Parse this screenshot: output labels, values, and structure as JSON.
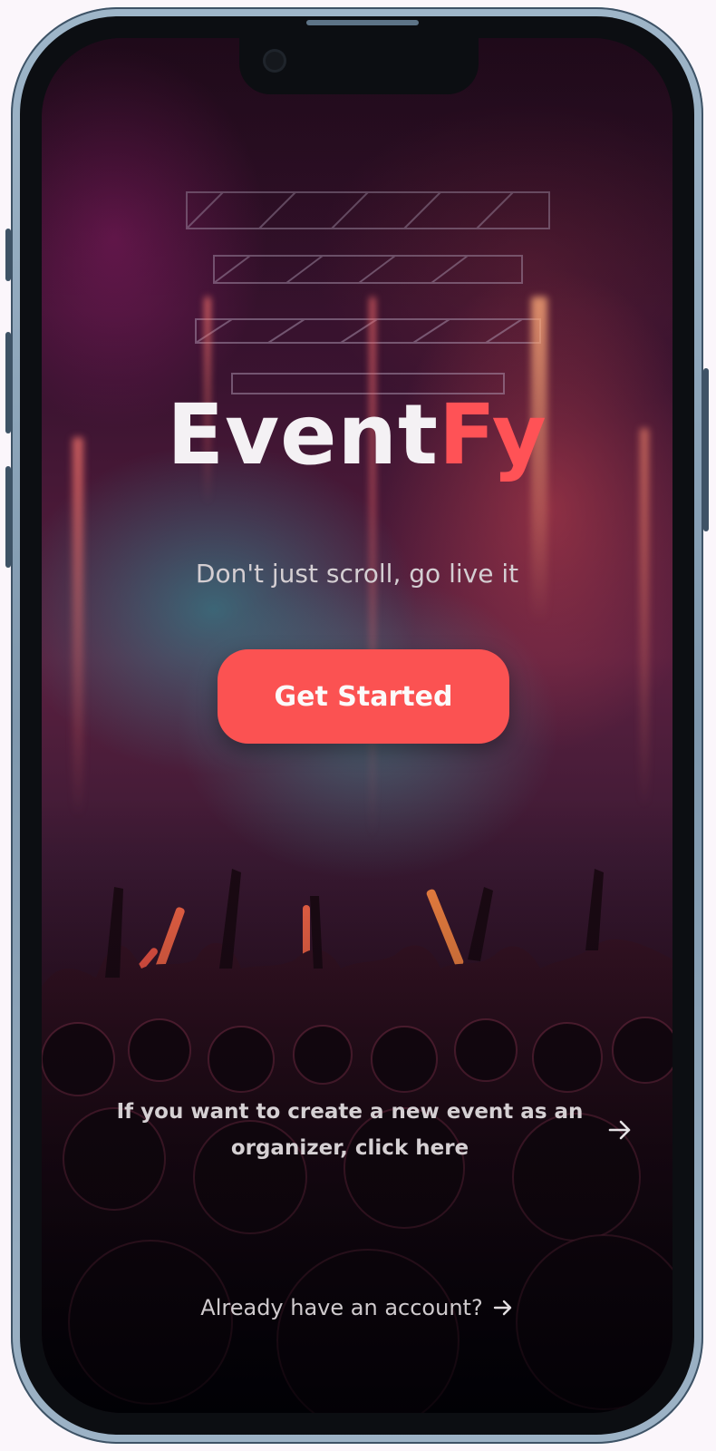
{
  "app": {
    "brand_part1": "Event",
    "brand_part2": "Fy",
    "tagline": "Don't just scroll, go live it"
  },
  "actions": {
    "get_started_label": "Get Started",
    "organizer_line1": "If you want to create a new event as an",
    "organizer_line2": "organizer, click here",
    "account_label": "Already have an account?"
  },
  "icons": {
    "organizer_arrow": "arrow-right-icon",
    "account_arrow": "arrow-right-icon"
  },
  "colors": {
    "accent": "#fb5252",
    "brand_highlight": "#ff5256",
    "text_light": "#f4f1f4"
  }
}
